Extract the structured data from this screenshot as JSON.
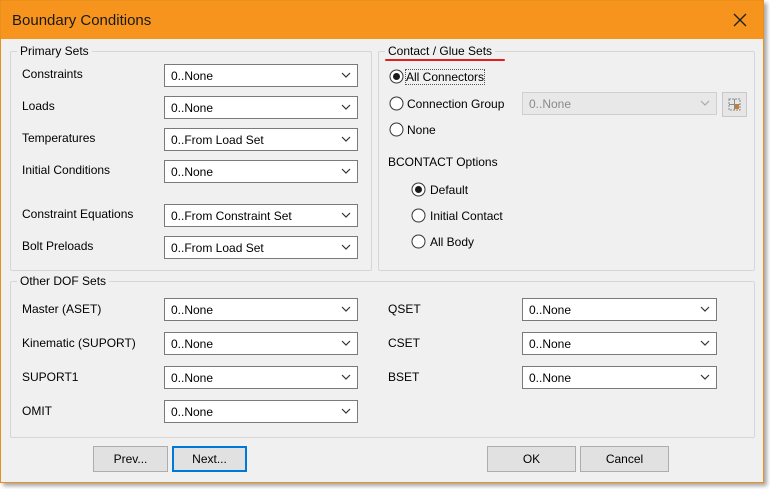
{
  "window": {
    "title": "Boundary Conditions"
  },
  "primary": {
    "title": "Primary Sets",
    "rows": [
      {
        "label": "Constraints",
        "value": "0..None"
      },
      {
        "label": "Loads",
        "value": "0..None"
      },
      {
        "label": "Temperatures",
        "value": "0..From Load Set"
      },
      {
        "label": "Initial Conditions",
        "value": "0..None"
      },
      {
        "label": "Constraint Equations",
        "value": "0..From Constraint Set"
      },
      {
        "label": "Bolt Preloads",
        "value": "0..From Load Set"
      }
    ]
  },
  "contact": {
    "title": "Contact / Glue Sets",
    "options": [
      {
        "label": "All Connectors",
        "selected": true
      },
      {
        "label": "Connection Group",
        "selected": false
      },
      {
        "label": "None",
        "selected": false
      }
    ],
    "group_value": "0..None",
    "bcontact_label": "BCONTACT Options",
    "bcontact_options": [
      {
        "label": "Default",
        "selected": true
      },
      {
        "label": "Initial Contact",
        "selected": false
      },
      {
        "label": "All Body",
        "selected": false
      }
    ]
  },
  "other": {
    "title": "Other DOF Sets",
    "left": [
      {
        "label": "Master (ASET)",
        "value": "0..None"
      },
      {
        "label": "Kinematic (SUPORT)",
        "value": "0..None"
      },
      {
        "label": "SUPORT1",
        "value": "0..None"
      },
      {
        "label": "OMIT",
        "value": "0..None"
      }
    ],
    "right": [
      {
        "label": "QSET",
        "value": "0..None"
      },
      {
        "label": "CSET",
        "value": "0..None"
      },
      {
        "label": "BSET",
        "value": "0..None"
      }
    ]
  },
  "buttons": {
    "prev": "Prev...",
    "next": "Next...",
    "ok": "OK",
    "cancel": "Cancel"
  },
  "icons": {
    "close": "close-icon",
    "dropdown": "chevron-down-icon",
    "select": "grid-select-icon"
  },
  "colors": {
    "titlebar": "#f7941d",
    "accent": "#0078d7",
    "highlight": "#e02020"
  }
}
